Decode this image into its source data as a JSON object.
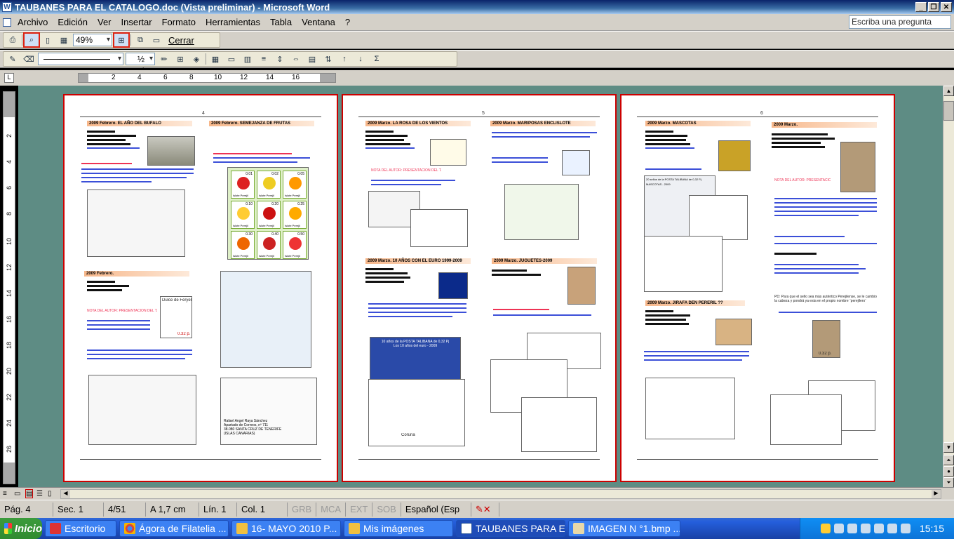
{
  "window": {
    "title": "TAUBANES PARA EL CATALOGO.doc (Vista preliminar) - Microsoft Word"
  },
  "menu": [
    "Archivo",
    "Edición",
    "Ver",
    "Insertar",
    "Formato",
    "Herramientas",
    "Tabla",
    "Ventana",
    "?"
  ],
  "ask_placeholder": "Escriba una pregunta",
  "preview_toolbar": {
    "zoom": "49%",
    "close_label": "Cerrar"
  },
  "format_toolbar": {
    "size": "½ pt"
  },
  "ruler_numbers": [
    "2",
    "4",
    "6",
    "8",
    "10",
    "12",
    "14",
    "16"
  ],
  "vruler_numbers": [
    "2",
    "4",
    "6",
    "8",
    "10",
    "12",
    "14",
    "16",
    "18",
    "20",
    "22",
    "24",
    "26"
  ],
  "pages": [
    {
      "number": "4",
      "sections": [
        {
          "title": "2009 Febrero.   EL AÑO DEL BUFALO"
        },
        {
          "title": "2009 Febrero.   SEMEJANZA DE FRUTAS"
        },
        {
          "title": "2009 Febrero."
        }
      ],
      "notice": "NOTA DEL AUTOR: PRESENTACION DEL TALEAN",
      "stamp_text": "Dulce de Feryel",
      "stamp_value": "0.32 p.",
      "addr": [
        "Rafael Angel Raya Sánchez",
        "Apartado de Correos, nº 711",
        "38.080 SANTA CRUZ DE TENERIFE",
        "(ISLAS CANARIAS)"
      ],
      "fruit_label": "Islote Perejil",
      "fruit_values": [
        "0.01",
        "0.02",
        "0.05",
        "0.10",
        "0.20",
        "0.25",
        "0.30",
        "0.40",
        "0.50"
      ]
    },
    {
      "number": "5",
      "sections": [
        {
          "title": "2009 Marzo.   LA ROSA DE LOS VIENTOS"
        },
        {
          "title": "2009 Marzo.   MARIPOSAS ENCLISLOTE"
        },
        {
          "title": "2009 Marzo.   10 AÑOS CON EL EURO 1999-2009"
        },
        {
          "title": "2009 Marzo.   JUGUETES-2009"
        }
      ],
      "notice": "NOTA DEL AUTOR: PRESENTACION DEL TALEAN",
      "euro_sheet": "10 años de la POSTA TALIBANA de 0,32 Pj",
      "euro_sub": "Los 10 años del euro - 2009",
      "addr_b": "Coruña"
    },
    {
      "number": "6",
      "sections": [
        {
          "title": "2009 Marzo.   MASCOTAS"
        },
        {
          "title": "2009 Marzo."
        },
        {
          "title": "2009 Marzo.   JIRAFA DEN PERERIL ??"
        }
      ],
      "notice": "NOTA DEL AUTOR: PRESENTACION DEL TALEAN",
      "mascot_sheet": "20 sellos de la POSTA TALIBANA de 0,32 Pj",
      "mascot_sub": "MASCOTAS - 2009",
      "statue_value": "0.32 p.",
      "note": "PD: Para que el sello sea más auténtico Perejilense, se le cambio la cabeza y pondrá ya esta en el propio nombre ¨perejilero¨"
    }
  ],
  "status": {
    "page": "Pág. 4",
    "sec": "Sec. 1",
    "pages": "4/51",
    "at": "A 1,7 cm",
    "line": "Lín. 1",
    "col": "Col. 1",
    "rec": "GRB",
    "mca": "MCA",
    "ext": "EXT",
    "sob": "SOB",
    "lang": "Español (Esp"
  },
  "taskbar": {
    "start": "Inicio",
    "tasks": [
      "Escritorio",
      "Ágora de Filatelia ...",
      "16- MAYO 2010  P...",
      "Mis imágenes",
      "TAUBANES PARA E...",
      "IMAGEN N °1.bmp ..."
    ],
    "clock": "15:15"
  },
  "colors": {
    "page_border": "#cc0000",
    "doc_bg": "#5e8c84",
    "title_grad": "#0a246a"
  }
}
